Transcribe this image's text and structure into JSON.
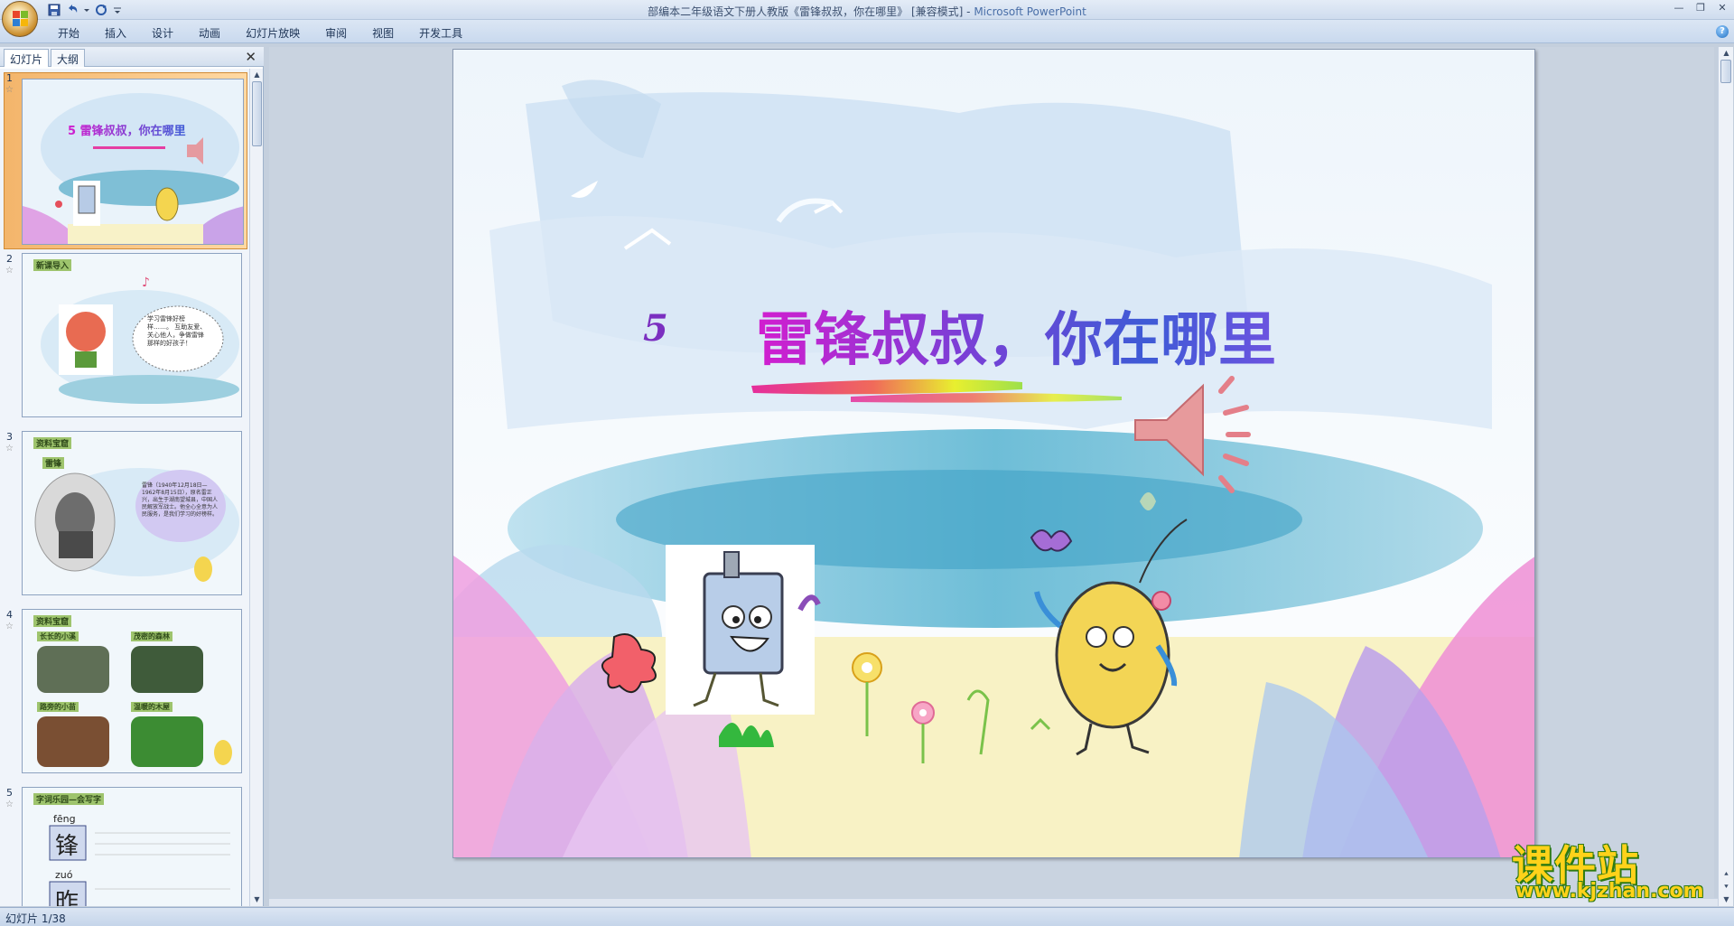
{
  "window": {
    "title_main": "部编本二年级语文下册人教版《雷锋叔叔，你在哪里》 [兼容模式] - ",
    "title_app": "Microsoft PowerPoint"
  },
  "ribbon": {
    "tabs": [
      "开始",
      "插入",
      "设计",
      "动画",
      "幻灯片放映",
      "审阅",
      "视图",
      "开发工具"
    ]
  },
  "left_pane": {
    "tabs": [
      "幻灯片",
      "大纲"
    ],
    "slides": [
      {
        "num": "1",
        "title": "雷锋叔叔，你在哪里",
        "selected": true
      },
      {
        "num": "2",
        "title": "新课导入",
        "bubble": "学习雷锋好榜样……。 互助友爱、关心他人，争做雷锋那样的好孩子！"
      },
      {
        "num": "3",
        "title": "资料宝窟",
        "subtitle": "雷锋",
        "bubble": "雷锋（1940年12月18日—1962年8月15日），原名雷正兴，出生于湖南望城县，中国人民解放军战士。他全心全意为人民服务，是我们学习的好榜样。"
      },
      {
        "num": "4",
        "title": "资料宝窟",
        "labels": [
          "长长的小溪",
          "茂密的森林",
          "路旁的小苗",
          "温暖的木屋"
        ]
      },
      {
        "num": "5",
        "title": "字词乐园—会写字",
        "chars": [
          {
            "pinyin": "fēng",
            "char": "锋"
          },
          {
            "pinyin": "zuó",
            "char": "昨"
          }
        ]
      }
    ]
  },
  "slide": {
    "number": "5",
    "title": "雷锋叔叔，你在哪里"
  },
  "status": {
    "text": "幻灯片 1/38"
  },
  "watermark": {
    "title": "课件站",
    "url": "www.kjzhan.com"
  },
  "colors": {
    "title_gradient_start": "#d21ecf",
    "title_gradient_end": "#3e5bd6",
    "selection": "#f4a44c"
  }
}
